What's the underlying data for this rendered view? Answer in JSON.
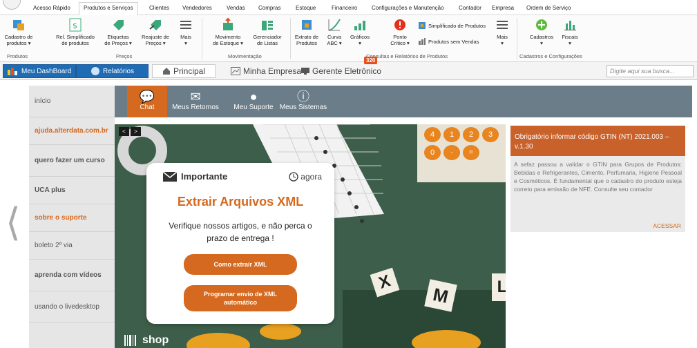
{
  "menu": {
    "tabs": [
      "Acesso Rápido",
      "Produtos e Serviços",
      "Clientes",
      "Vendedores",
      "Vendas",
      "Compras",
      "Estoque",
      "Financeiro",
      "Configurações e Manutenção",
      "Contador",
      "Empresa",
      "Ordem de Serviço"
    ],
    "active": "Produtos e Serviços"
  },
  "ribbon": {
    "cadastro": [
      "Cadastro de",
      "produtos ▾"
    ],
    "relsimpl": [
      "Rel. Simplificado",
      "de produtos"
    ],
    "etiquetas": [
      "Etiquetas",
      "de Preços ▾"
    ],
    "reajuste": [
      "Reajuste de",
      "Preços ▾"
    ],
    "mais1": [
      "Mais",
      "▾"
    ],
    "movimento": [
      "Movimento",
      "de Estoque ▾"
    ],
    "gerenciador": [
      "Gerenciador",
      "de Listas"
    ],
    "extrato": [
      "Extrato de",
      "Produtos"
    ],
    "curva": [
      "Curva",
      "ABC ▾"
    ],
    "graficos": [
      "Gráficos",
      "▾"
    ],
    "ponto": [
      "Ponto",
      "Crítico ▾"
    ],
    "simplificado": "Simplificado de Produtos",
    "semvendas": "Produtos sem Vendas",
    "mais2": [
      "Mais",
      "▾"
    ],
    "cadastros": [
      "Cadastros",
      "▾"
    ],
    "fiscais": [
      "Fiscais",
      "▾"
    ],
    "groups": {
      "produtos": "Produtos",
      "precos": "Preços",
      "movimentacao": "Movimentação",
      "consultas": "Consultas e Relatórios de Produtos",
      "cadconf": "Cadastros e Configurações"
    }
  },
  "nav": {
    "dashboard": "Meu DashBoard",
    "relatorios": "Relatórios",
    "principal": "Principal",
    "minhaempresa": "Minha Empresa",
    "gerente": "Gerente Eletrônico",
    "badge": "320",
    "search_placeholder": "Digite aqui sua busca..."
  },
  "sidebar": {
    "items": [
      {
        "label": "início",
        "style": "normal"
      },
      {
        "label": "ajuda.alterdata.com.br",
        "style": "orange"
      },
      {
        "label": "quero fazer um curso",
        "style": "bold"
      },
      {
        "label": "UCA plus",
        "style": "bold"
      },
      {
        "label": "sobre o suporte",
        "style": "orange"
      },
      {
        "label": "boleto 2º via",
        "style": "normal"
      },
      {
        "label": "aprenda com vídeos",
        "style": "bold"
      },
      {
        "label": "usando o livedesktop",
        "style": "normal"
      }
    ]
  },
  "support_tabs": [
    {
      "label": "Chat",
      "icon": "chat-icon"
    },
    {
      "label": "Meus Retornos",
      "icon": "envelope-icon"
    },
    {
      "label": "Meu Suporte",
      "icon": "user-icon"
    },
    {
      "label": "Meus Sistemas",
      "icon": "info-icon"
    }
  ],
  "banner": {
    "header": "Importante",
    "time": "agora",
    "title": "Extrair Arquivos XML",
    "text": "Verifique nossos artigos, e não perca o prazo de entrega !",
    "btn1": "Como extrair XML",
    "btn2": "Programar envio de XML automático",
    "shop": "shop",
    "letters": [
      "X",
      "M",
      "L"
    ],
    "calc_keys": [
      "4",
      "1",
      "2",
      "3",
      "0",
      "·",
      "="
    ]
  },
  "notice": {
    "title": "Obrigatório informar código GTIN (NT) 2021.003 – v.1.30",
    "body": "A sefaz passou a validar o GTIN para Grupos de Produtos: Bebidas e Refrigerantes, Cimento, Perfumaria, Higiene Pessoal e Cosméticos. É fundamental que o cadastro do produto esteja correto para emissão de NFE. Consulte seu contador",
    "action": "ACESSAR"
  },
  "colors": {
    "accent": "#d4691f",
    "strip": "#6b7d89",
    "blue": "#1f6cb4",
    "banner_bg": "#3d5e4a"
  }
}
